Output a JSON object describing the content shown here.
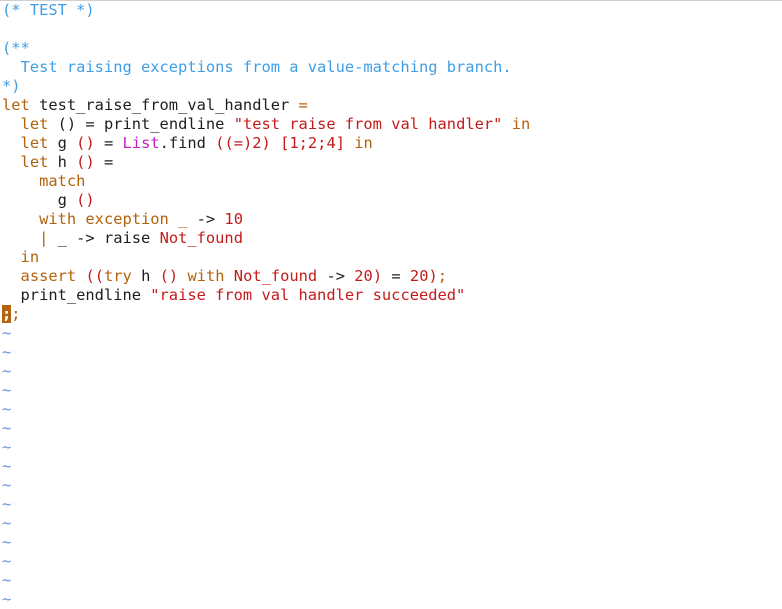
{
  "colors": {
    "background": "#ffffff",
    "comment": "#3f9ee6",
    "keyword": "#b3620c",
    "string": "#c41a1a",
    "module": "#c51fc5",
    "delimiter": "#c41a1a",
    "constructor": "#c41a1a",
    "number": "#c41a1a",
    "text": "#1e1e1e",
    "tilde": "#6b8fe0",
    "cursor": "#b4630e"
  },
  "editor": {
    "lines": [
      [
        {
          "t": "(* TEST *)",
          "c": "comment"
        }
      ],
      [],
      [
        {
          "t": "(**",
          "c": "comment"
        }
      ],
      [
        {
          "t": "  Test raising exceptions from a value-matching branch.",
          "c": "comment"
        }
      ],
      [
        {
          "t": "*)",
          "c": "comment"
        }
      ],
      [
        {
          "t": "let",
          "c": "keyword"
        },
        {
          "t": " test_raise_from_val_handler ",
          "c": "text"
        },
        {
          "t": "=",
          "c": "keyword"
        }
      ],
      [
        {
          "t": "  ",
          "c": "text"
        },
        {
          "t": "let",
          "c": "keyword"
        },
        {
          "t": " () = print_endline ",
          "c": "text"
        },
        {
          "t": "\"test raise from val handler\"",
          "c": "string"
        },
        {
          "t": " ",
          "c": "text"
        },
        {
          "t": "in",
          "c": "keyword"
        }
      ],
      [
        {
          "t": "  ",
          "c": "text"
        },
        {
          "t": "let",
          "c": "keyword"
        },
        {
          "t": " g ",
          "c": "text"
        },
        {
          "t": "()",
          "c": "delimiter"
        },
        {
          "t": " = ",
          "c": "text"
        },
        {
          "t": "List",
          "c": "module"
        },
        {
          "t": ".find ",
          "c": "text"
        },
        {
          "t": "((=)2)",
          "c": "delimiter"
        },
        {
          "t": " ",
          "c": "text"
        },
        {
          "t": "[1;2;4]",
          "c": "delimiter"
        },
        {
          "t": " ",
          "c": "text"
        },
        {
          "t": "in",
          "c": "keyword"
        }
      ],
      [
        {
          "t": "  ",
          "c": "text"
        },
        {
          "t": "let",
          "c": "keyword"
        },
        {
          "t": " h ",
          "c": "text"
        },
        {
          "t": "()",
          "c": "delimiter"
        },
        {
          "t": " =",
          "c": "text"
        }
      ],
      [
        {
          "t": "    ",
          "c": "text"
        },
        {
          "t": "match",
          "c": "keyword"
        }
      ],
      [
        {
          "t": "      g ",
          "c": "text"
        },
        {
          "t": "()",
          "c": "delimiter"
        }
      ],
      [
        {
          "t": "    ",
          "c": "text"
        },
        {
          "t": "with exception _",
          "c": "keyword"
        },
        {
          "t": " -> ",
          "c": "text"
        },
        {
          "t": "10",
          "c": "number"
        }
      ],
      [
        {
          "t": "    ",
          "c": "text"
        },
        {
          "t": "|",
          "c": "keyword"
        },
        {
          "t": " _ -> raise ",
          "c": "text"
        },
        {
          "t": "Not_found",
          "c": "constructor"
        }
      ],
      [
        {
          "t": "  ",
          "c": "text"
        },
        {
          "t": "in",
          "c": "keyword"
        }
      ],
      [
        {
          "t": "  ",
          "c": "text"
        },
        {
          "t": "assert",
          "c": "keyword"
        },
        {
          "t": " ",
          "c": "text"
        },
        {
          "t": "((",
          "c": "delimiter"
        },
        {
          "t": "try",
          "c": "keyword"
        },
        {
          "t": " h ",
          "c": "text"
        },
        {
          "t": "()",
          "c": "delimiter"
        },
        {
          "t": " ",
          "c": "text"
        },
        {
          "t": "with",
          "c": "keyword"
        },
        {
          "t": " ",
          "c": "text"
        },
        {
          "t": "Not_found",
          "c": "constructor"
        },
        {
          "t": " -> ",
          "c": "text"
        },
        {
          "t": "20",
          "c": "number"
        },
        {
          "t": ")",
          "c": "delimiter"
        },
        {
          "t": " = ",
          "c": "text"
        },
        {
          "t": "20",
          "c": "number"
        },
        {
          "t": ")",
          "c": "delimiter"
        },
        {
          "t": ";",
          "c": "keyword"
        }
      ],
      [
        {
          "t": "  print_endline ",
          "c": "text"
        },
        {
          "t": "\"raise from val handler succeeded\"",
          "c": "string"
        }
      ],
      [
        {
          "t": ";",
          "c": "cursor"
        },
        {
          "t": ";",
          "c": "keyword"
        }
      ]
    ],
    "empty_line_marker": "~",
    "empty_line_count": 15
  }
}
